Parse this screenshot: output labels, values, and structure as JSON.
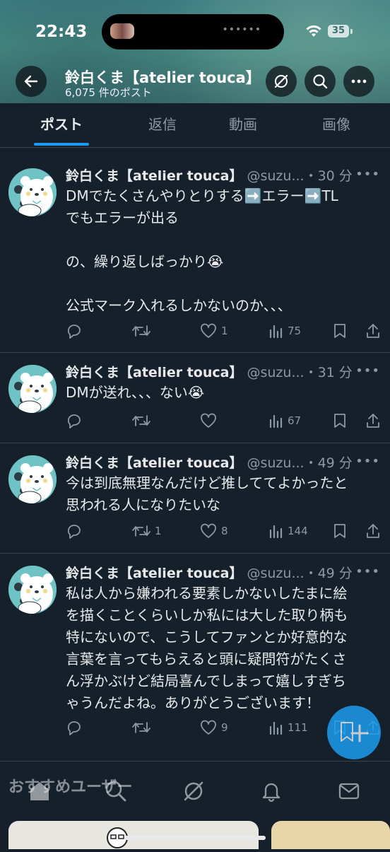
{
  "status": {
    "time": "22:43",
    "battery": "35"
  },
  "profile": {
    "title": "鈴白くま【atelier touca】",
    "post_count": "6,075 件のポスト"
  },
  "tabs": [
    {
      "label": "ポスト"
    },
    {
      "label": "返信"
    },
    {
      "label": "動画"
    },
    {
      "label": "画像"
    }
  ],
  "tweets": [
    {
      "name": "鈴白くま【atelier touca】",
      "handle": "@suzu...",
      "time": "・30 分",
      "lines": [
        "DMでたくさんやりとりする➡️エラー➡️TL",
        "でもエラーが出る",
        "",
        "の、繰り返しばっかり😭",
        "",
        "公式マーク入れるしかないのか、、、"
      ],
      "replies": "",
      "reposts": "",
      "likes": "1",
      "views": "75"
    },
    {
      "name": "鈴白くま【atelier touca】",
      "handle": "@suzu...",
      "time": "・31 分",
      "lines": [
        "DMが送れ、、、ない😭"
      ],
      "replies": "",
      "reposts": "",
      "likes": "",
      "views": "67"
    },
    {
      "name": "鈴白くま【atelier touca】",
      "handle": "@suzu...",
      "time": "・49 分",
      "lines": [
        "今は到底無理なんだけど推しててよかったと",
        "思われる人になりたいな"
      ],
      "replies": "",
      "reposts": "1",
      "likes": "8",
      "views": "144"
    },
    {
      "name": "鈴白くま【atelier touca】",
      "handle": "@suzu...",
      "time": "・49 分",
      "lines": [
        "私は人から嫌われる要素しかないしたまに絵",
        "を描くことくらいしか私には大した取り柄も",
        "特にないので、こうしてファンとか好意的な",
        "言葉を言ってもらえると頭に疑問符がたくさ",
        "ん浮かぶけど結局喜んでしまって嬉しすぎち",
        "ゃうんだよね。ありがとうございます！"
      ],
      "replies": "",
      "reposts": "",
      "likes": "9",
      "views": "111"
    }
  ],
  "recommend": {
    "heading": "おすすめユーザー"
  },
  "icons": [
    "back-arrow-icon",
    "grok-icon",
    "search-icon",
    "more-icon",
    "reply-icon",
    "repost-icon",
    "like-icon",
    "views-icon",
    "bookmark-icon",
    "share-icon",
    "home-icon",
    "notifications-icon",
    "messages-icon"
  ],
  "colors": {
    "accent": "#1d9bf0",
    "background": "#15202b",
    "muted": "#8b98a5"
  }
}
